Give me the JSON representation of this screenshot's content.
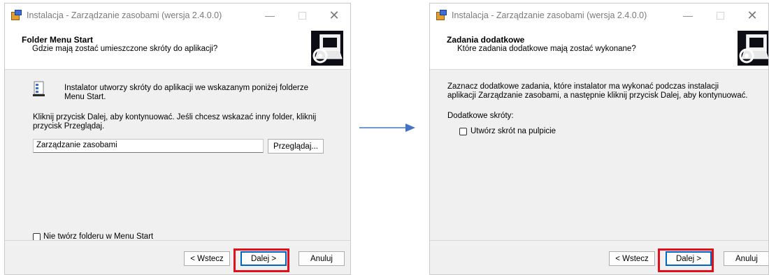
{
  "left_window": {
    "title": "Instalacja - Zarządzanie zasobami (wersja 2.4.0.0)",
    "header_title": "Folder Menu Start",
    "header_subtitle": "Gdzie mają zostać umieszczone skróty do aplikacji?",
    "info_text": "Instalator utworzy skróty do aplikacji we wskazanym poniżej folderze Menu Start.",
    "instruction": "Kliknij przycisk Dalej, aby kontynuować. Jeśli chcesz wskazać inny folder, kliknij przycisk Przeglądaj.",
    "folder_value": "Zarządzanie zasobami",
    "browse_label": "Przeglądaj...",
    "no_folder_checkbox": "Nie twórz folderu w Menu Start",
    "back_label": "< Wstecz",
    "next_label": "Dalej >",
    "cancel_label": "Anuluj"
  },
  "right_window": {
    "title": "Instalacja - Zarządzanie zasobami (wersja 2.4.0.0)",
    "header_title": "Zadania dodatkowe",
    "header_subtitle": "Które zadania dodatkowe mają zostać wykonane?",
    "description": "Zaznacz dodatkowe zadania, które instalator ma wykonać podczas instalacji aplikacji Zarządzanie zasobami, a następnie kliknij przycisk Dalej, aby kontynuować.",
    "extra_shortcuts_label": "Dodatkowe skróty:",
    "desktop_checkbox": "Utwórz skrót na pulpicie",
    "back_label": "< Wstecz",
    "next_label": "Dalej >",
    "cancel_label": "Anuluj"
  },
  "colors": {
    "highlight": "#e0101c",
    "arrow": "#4472c4",
    "panel_bg": "#f0f0f0"
  },
  "icons": {
    "title_icon": "installer-icon",
    "header_image": "computer-install-icon",
    "info_icon": "start-menu-folder-icon",
    "arrow": "arrow-right-icon"
  }
}
